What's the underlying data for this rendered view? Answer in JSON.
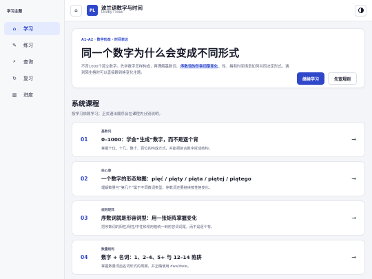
{
  "sidebar": {
    "title": "学习主题",
    "items": [
      {
        "icon": "⌂",
        "label": "学习",
        "active": true
      },
      {
        "icon": "✎",
        "label": "练习",
        "active": false
      },
      {
        "icon": "⌕",
        "label": "查询",
        "active": false
      },
      {
        "icon": "↻",
        "label": "复习",
        "active": false
      },
      {
        "icon": "▥",
        "label": "进度",
        "active": false
      }
    ]
  },
  "topbar": {
    "home_icon": "⌂",
    "logo_text": "PL",
    "title": "波兰语数字与时间",
    "subtitle": "Liczby i czas"
  },
  "hero": {
    "kicker": "A1–A2 · 数字形态 · 时间表达",
    "title": "同一个数字为什么会变成不同形式",
    "desc_before": "不背1000个孤立数字。先学数字怎样构成，再理解基数词、",
    "desc_highlight": "序数词的形容词型变化",
    "desc_after": "、性、格和时间场景如何共同决定形式。遇到陌生格时可以直接跳到格变化主题。",
    "primary_button": "继续学习",
    "secondary_button": "先查规则"
  },
  "courses_section": {
    "title": "系统课程",
    "subtitle": "按学习依赖学习；正式语法顺序会在课程内分别说明。",
    "courses": [
      {
        "num": "01",
        "tag": "基数词",
        "title": "0–1000：学会“生成”数字，而不是逐个背",
        "desc": "掌握个位、十几、整十、百位的构成方式，并能把复合数字拆成结构。",
        "arrow": "→"
      },
      {
        "num": "02",
        "tag": "核心章",
        "title": "一个数字的形态地图：pięć / piąty / piąta / piątej / piątego",
        "desc": "理解数量与“第几个”属于不同数词类型，序数词还要继续按性格变化。",
        "arrow": "→"
      },
      {
        "num": "03",
        "tag": "规则矩阵",
        "title": "序数词就是形容词型：用一张矩阵掌握变化",
        "desc": "把序数词的阳性/阴性/中性和常用格统一到形容词词尾，而不是逐个背。",
        "arrow": "→"
      },
      {
        "num": "04",
        "tag": "数量结构",
        "title": "数字 + 名词：1、2–4、5+ 与 12–14 陷阱",
        "desc": "掌握数量词后名词形式的周期，并正确使用 dwa/dwie。",
        "arrow": "→"
      }
    ]
  },
  "colors": {
    "accent": "#2f47c9",
    "active_nav_bg": "#e5ebff",
    "page_bg": "#f4f5f8"
  }
}
